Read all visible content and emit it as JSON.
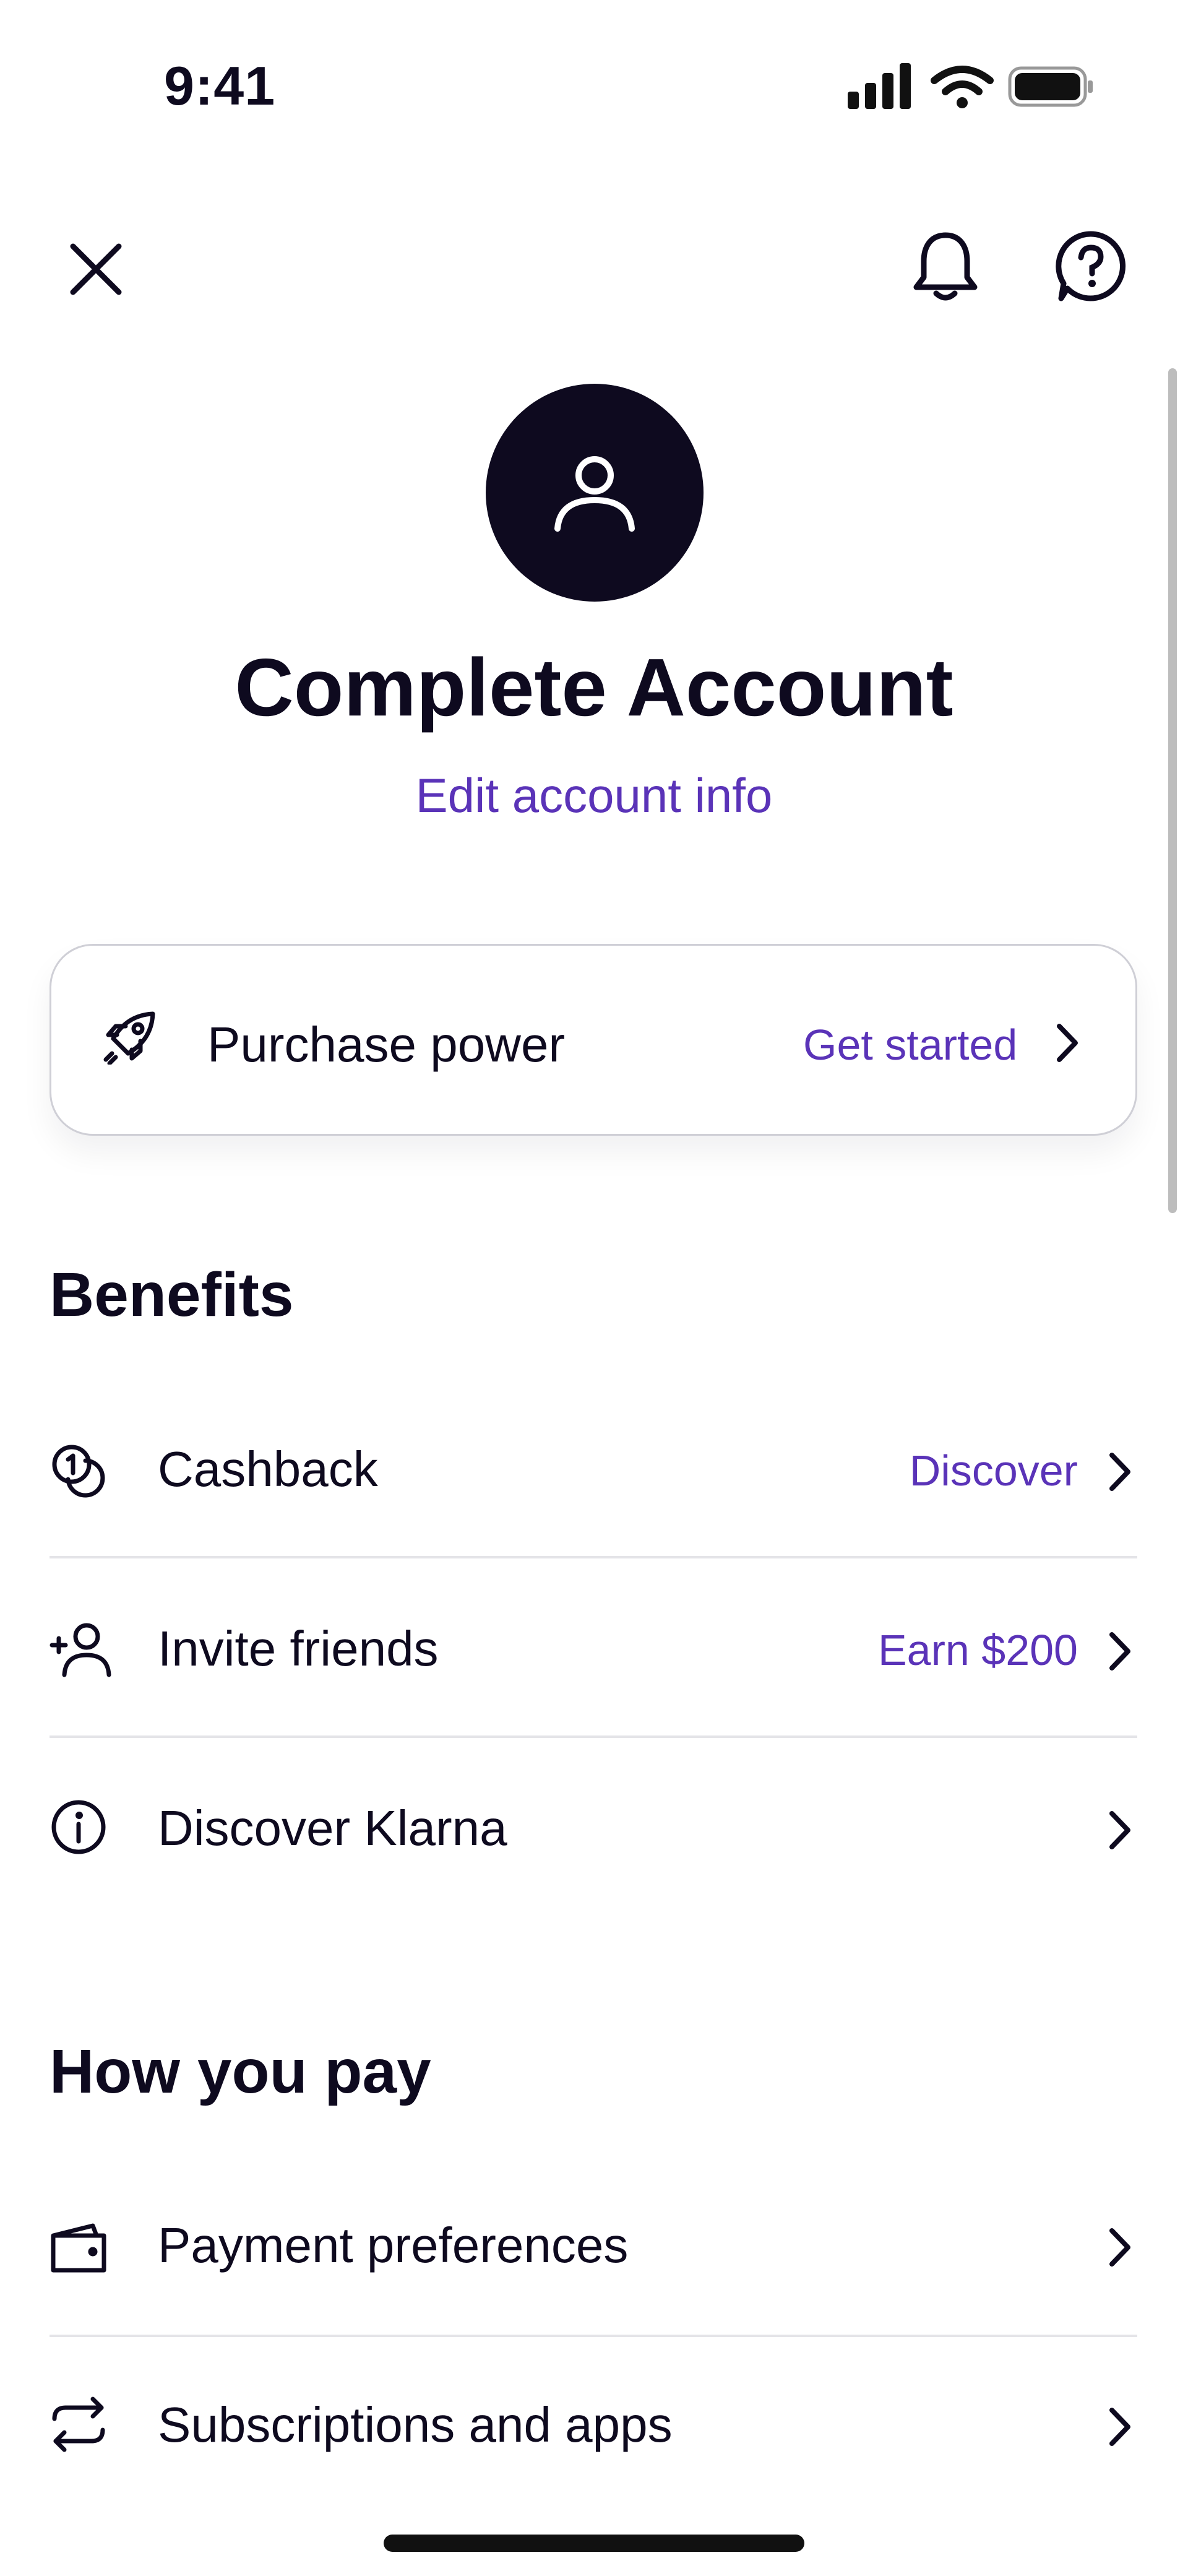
{
  "status_bar": {
    "time": "9:41"
  },
  "header": {
    "title": "Complete Account",
    "edit_link": "Edit account info"
  },
  "purchase_card": {
    "label": "Purchase power",
    "action": "Get started"
  },
  "benefits": {
    "title": "Benefits",
    "items": [
      {
        "label": "Cashback",
        "action": "Discover",
        "icon": "cashback-coins-icon"
      },
      {
        "label": "Invite friends",
        "action": "Earn $200",
        "icon": "add-user-icon"
      },
      {
        "label": "Discover Klarna",
        "action": "",
        "icon": "info-icon"
      }
    ]
  },
  "how_you_pay": {
    "title": "How you pay",
    "items": [
      {
        "label": "Payment preferences",
        "icon": "wallet-icon"
      },
      {
        "label": "Subscriptions and apps",
        "icon": "repeat-arrows-icon"
      }
    ]
  },
  "colors": {
    "accent": "#5a33b8",
    "text": "#0e0a1f",
    "divider": "#e4e4e8"
  }
}
